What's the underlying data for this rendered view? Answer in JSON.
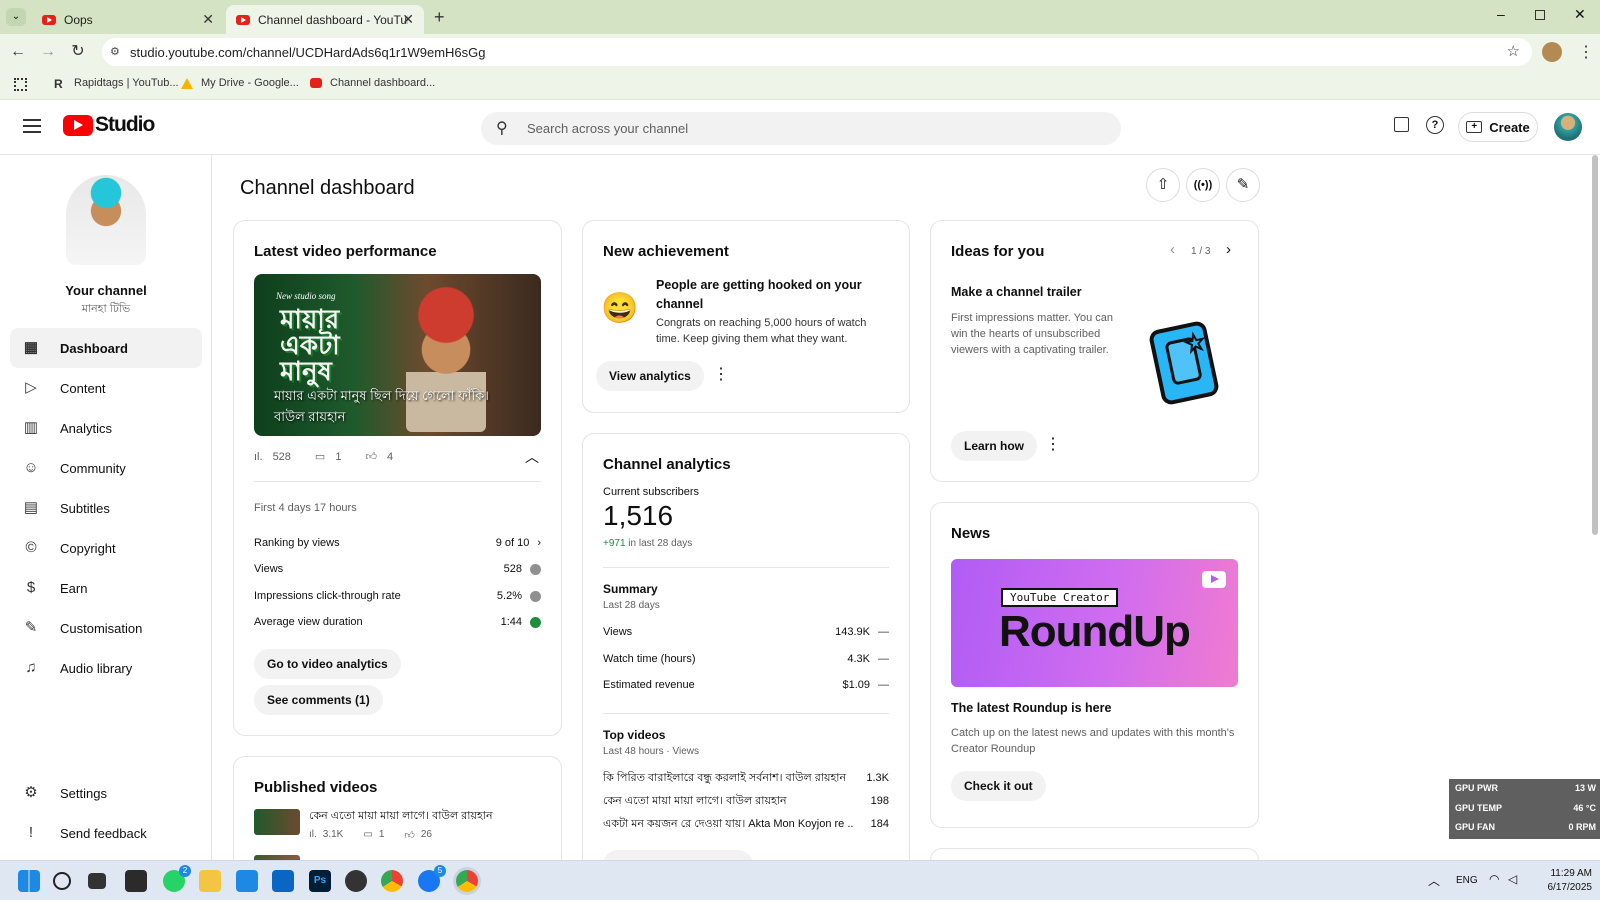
{
  "browser": {
    "tabs": [
      {
        "label": "Oops"
      },
      {
        "label": "Channel dashboard - YouTube S"
      }
    ],
    "url": "studio.youtube.com/channel/UCDHardAds6q1r1W9emH6sGg",
    "bookmarks": [
      {
        "label": "Rapidtags | YouTub..."
      },
      {
        "label": "My Drive - Google..."
      },
      {
        "label": "Channel dashboard..."
      }
    ]
  },
  "header": {
    "logo_text": "Studio",
    "search_placeholder": "Search across your channel",
    "create_label": "Create"
  },
  "sidebar": {
    "channel_label": "Your channel",
    "channel_name": "মানহা টিভি",
    "items": [
      {
        "label": "Dashboard"
      },
      {
        "label": "Content"
      },
      {
        "label": "Analytics"
      },
      {
        "label": "Community"
      },
      {
        "label": "Subtitles"
      },
      {
        "label": "Copyright"
      },
      {
        "label": "Earn"
      },
      {
        "label": "Customisation"
      },
      {
        "label": "Audio library"
      }
    ],
    "bottom": [
      {
        "label": "Settings"
      },
      {
        "label": "Send feedback"
      }
    ]
  },
  "page": {
    "title": "Channel dashboard"
  },
  "latest": {
    "title": "Latest video performance",
    "thumb_small": "New studio song",
    "thumb_big": "মায়ার একটা মানুষ",
    "thumb_caption1": "মায়ার একটা মানুষ ছিল দিয়ে গেলো ফাঁকি।",
    "thumb_caption2": "বাউল রায়হান",
    "views_count": "528",
    "comments_count": "1",
    "likes_count": "4",
    "period": "First 4 days 17 hours",
    "metrics": [
      {
        "label": "Ranking by views",
        "value": "9 of 10"
      },
      {
        "label": "Views",
        "value": "528"
      },
      {
        "label": "Impressions click-through rate",
        "value": "5.2%"
      },
      {
        "label": "Average view duration",
        "value": "1:44"
      }
    ],
    "btn_analytics": "Go to video analytics",
    "btn_comments": "See comments (1)"
  },
  "published": {
    "title": "Published videos",
    "items": [
      {
        "title": "কেন এতো মায়া মায়া লাগে। বাউল রায়হান",
        "views": "3.1K",
        "comments": "1",
        "likes": "26"
      }
    ]
  },
  "achievement": {
    "title": "New achievement",
    "emoji": "😄",
    "headline": "People are getting hooked on your channel",
    "body": "Congrats on reaching 5,000 hours of watch time. Keep giving them what they want.",
    "btn": "View analytics"
  },
  "analytics": {
    "title": "Channel analytics",
    "subs_label": "Current subscribers",
    "subs_value": "1,516",
    "subs_change": "+971",
    "subs_change_suffix": " in last 28 days",
    "summary_title": "Summary",
    "summary_period": "Last 28 days",
    "summary": [
      {
        "label": "Views",
        "value": "143.9K"
      },
      {
        "label": "Watch time (hours)",
        "value": "4.3K"
      },
      {
        "label": "Estimated revenue",
        "value": "$1.09"
      }
    ],
    "top_title": "Top videos",
    "top_period": "Last 48 hours · Views",
    "top": [
      {
        "title": "কি পিরিত বারাইলারে বন্ধু করলাই সর্বনাশ। বাউল রায়হান",
        "value": "1.3K"
      },
      {
        "title": "কেন এতো মায়া মায়া লাগে। বাউল রায়হান",
        "value": "198"
      },
      {
        "title": "একটা মন কয়জন রে দেওয়া যায়। Akta Mon Koyjon re ...",
        "value": "184"
      }
    ]
  },
  "ideas": {
    "title": "Ideas for you",
    "pager": "1 / 3",
    "headline": "Make a channel trailer",
    "body": "First impressions matter. You can win the hearts of unsubscribed viewers with a captivating trailer.",
    "btn": "Learn how"
  },
  "news": {
    "title": "News",
    "banner_tag": "YouTube Creator",
    "banner_big": "RoundUp",
    "headline": "The latest Roundup is here",
    "body": "Catch up on the latest news and updates with this month's Creator Roundup",
    "btn": "Check it out"
  },
  "gpu": [
    {
      "label": "GPU PWR",
      "value": "13 W"
    },
    {
      "label": "GPU TEMP",
      "value": "46 °C"
    },
    {
      "label": "GPU FAN",
      "value": "0 RPM"
    }
  ],
  "taskbar": {
    "lang": "ENG",
    "time": "11:29 AM",
    "date": "6/17/2025",
    "whatsapp_badge": "2",
    "messenger_badge": "5"
  },
  "colors": {
    "yt_red": "#ff0000",
    "positive": "#1e8e3e",
    "news_gradient_start": "#b05cf5",
    "news_gradient_end": "#f07bd0"
  }
}
